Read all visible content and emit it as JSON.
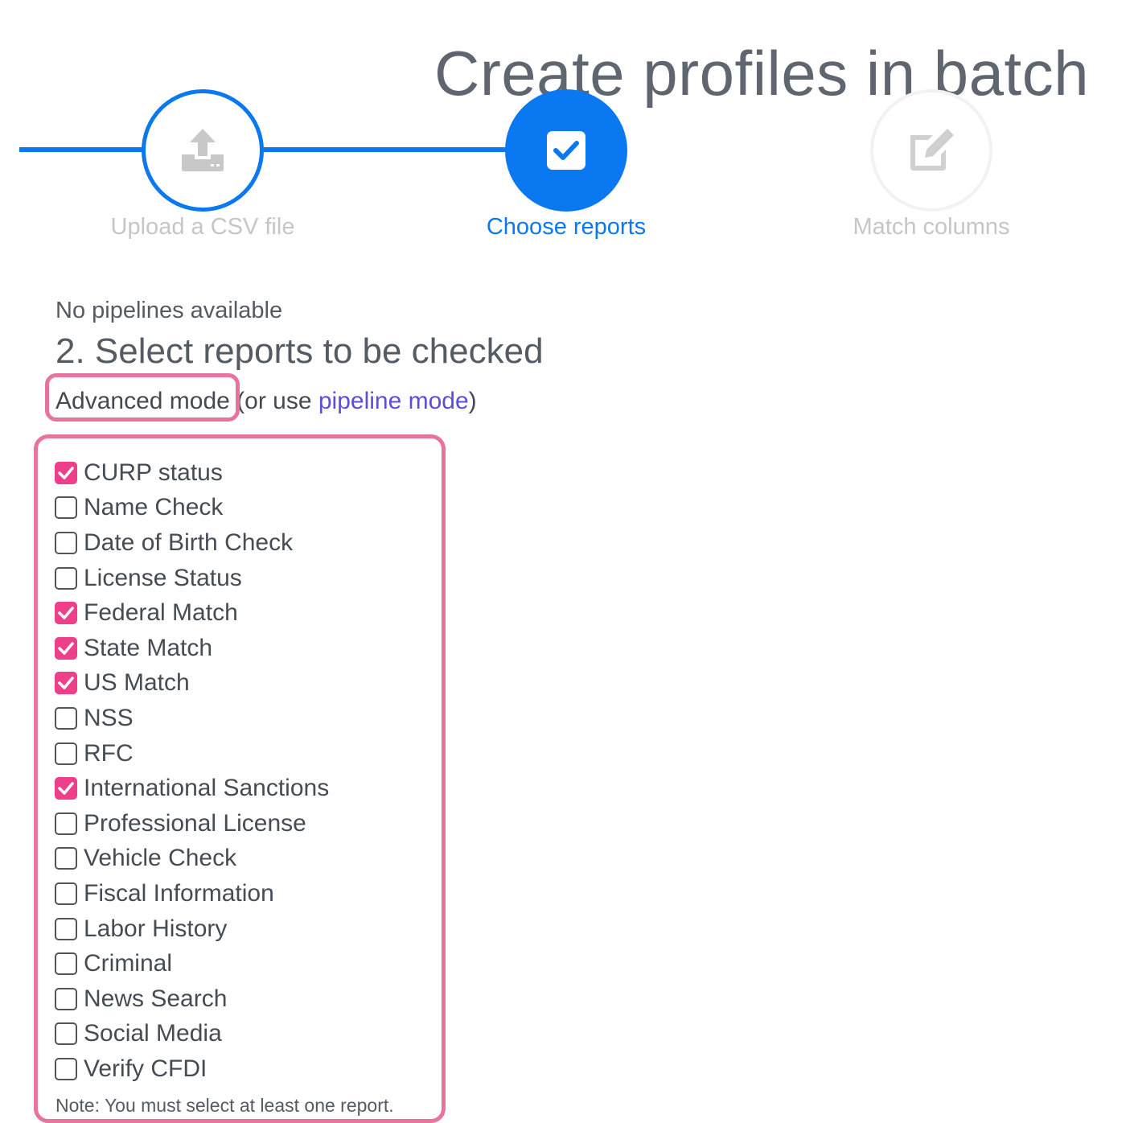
{
  "page": {
    "title": "Create profiles in batch"
  },
  "steps": [
    {
      "label": "Upload a CSV file",
      "icon": "upload-icon",
      "state": "completed"
    },
    {
      "label": "Choose reports",
      "icon": "checkbox-icon",
      "state": "active"
    },
    {
      "label": "Match columns",
      "icon": "edit-icon",
      "state": "inactive"
    }
  ],
  "content": {
    "no_pipelines": "No pipelines available",
    "section_title": "2. Select reports to be checked",
    "mode_current": "Advanced mode",
    "mode_prefix": " (or use ",
    "mode_link": "pipeline mode",
    "mode_suffix": ")"
  },
  "reports": [
    {
      "label": "CURP status",
      "checked": true
    },
    {
      "label": "Name Check",
      "checked": false
    },
    {
      "label": "Date of Birth Check",
      "checked": false
    },
    {
      "label": "License Status",
      "checked": false
    },
    {
      "label": "Federal Match",
      "checked": true
    },
    {
      "label": "State Match",
      "checked": true
    },
    {
      "label": "US Match",
      "checked": true
    },
    {
      "label": "NSS",
      "checked": false
    },
    {
      "label": "RFC",
      "checked": false
    },
    {
      "label": "International Sanctions",
      "checked": true
    },
    {
      "label": "Professional License",
      "checked": false
    },
    {
      "label": "Vehicle Check",
      "checked": false
    },
    {
      "label": "Fiscal Information",
      "checked": false
    },
    {
      "label": "Labor History",
      "checked": false
    },
    {
      "label": "Criminal",
      "checked": false
    },
    {
      "label": "News Search",
      "checked": false
    },
    {
      "label": "Social Media",
      "checked": false
    },
    {
      "label": "Verify CFDI",
      "checked": false
    }
  ],
  "note": "Note: You must select at least one report.",
  "colors": {
    "primary": "#0a78f0",
    "checked": "#ef3f8b",
    "highlight": "#e8739f",
    "link": "#5b4fd9",
    "muted": "#c6c6c6"
  }
}
